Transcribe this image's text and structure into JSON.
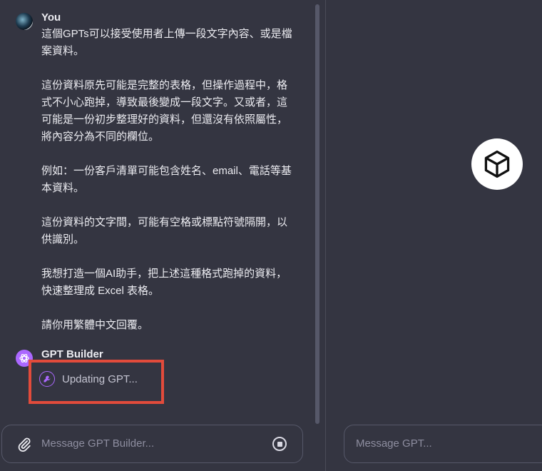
{
  "conversation": {
    "user": {
      "name": "You",
      "paragraphs": [
        "這個GPTs可以接受使用者上傳一段文字內容、或是檔案資料。",
        "這份資料原先可能是完整的表格，但操作過程中，格式不小心跑掉，導致最後變成一段文字。又或者，這可能是一份初步整理好的資料，但還沒有依照屬性，將內容分為不同的欄位。",
        "例如：一份客戶清單可能包含姓名、email、電話等基本資料。",
        "這份資料的文字間，可能有空格或標點符號隔開，以供識別。",
        "我想打造一個AI助手，把上述這種格式跑掉的資料，快速整理成 Excel 表格。",
        "請你用繁體中文回覆。"
      ]
    },
    "builder": {
      "name": "GPT Builder",
      "status": "Updating GPT..."
    }
  },
  "composer_left": {
    "placeholder": "Message GPT Builder..."
  },
  "composer_right": {
    "placeholder": "Message GPT..."
  },
  "icons": {
    "attach": "paperclip-icon",
    "stop": "stop-icon",
    "status": "wrench-icon",
    "builder_avatar": "openai-logo-icon",
    "preview": "cube-icon"
  },
  "colors": {
    "background": "#343541",
    "accent": "#ab68ff",
    "highlight": "#e24b3b"
  }
}
